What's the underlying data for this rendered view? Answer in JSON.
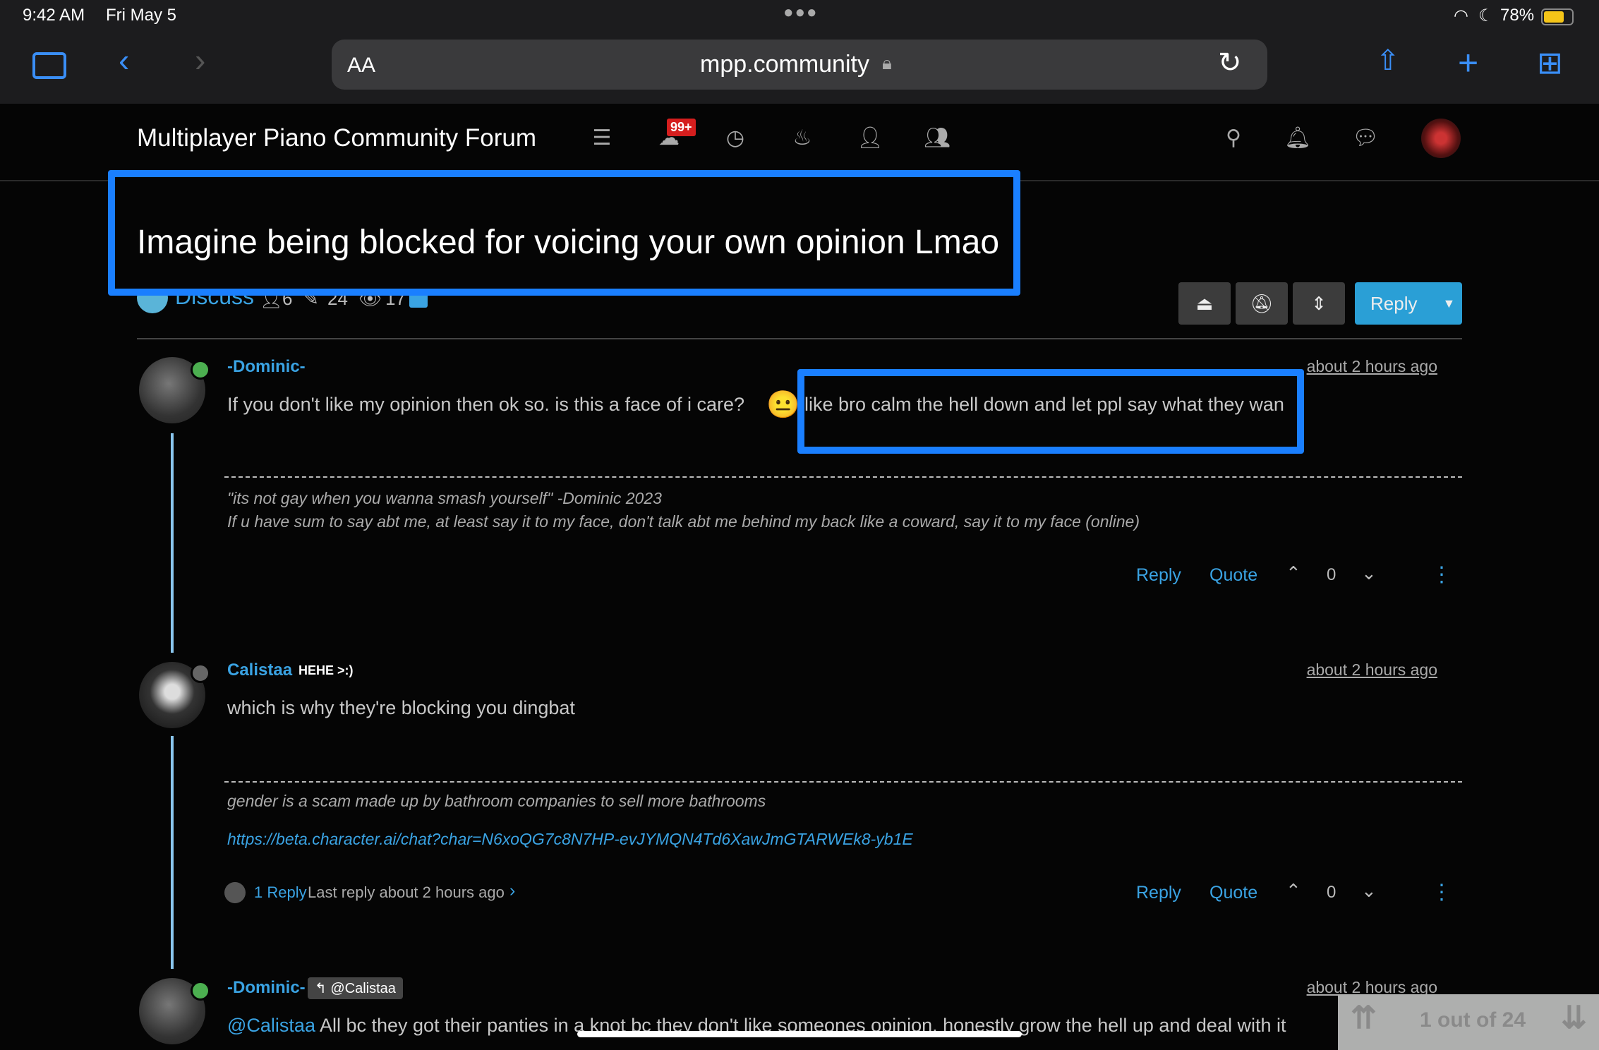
{
  "status_bar": {
    "time": "9:42 AM",
    "date": "Fri May 5",
    "battery": "78%"
  },
  "browser": {
    "text_size": "AA",
    "url": "mpp.community"
  },
  "forum": {
    "title": "Multiplayer Piano Community Forum",
    "unread_badge": "99+"
  },
  "topic": {
    "title": "Imagine being blocked for voicing your own opinion Lmao",
    "category": "Discuss",
    "posters": "6",
    "posts": "24",
    "views": "17",
    "reply_label": "Reply"
  },
  "posts": [
    {
      "author": "-Dominic-",
      "time": "about 2 hours ago",
      "body": "If you don't like my opinion then ok so. is this a face of i care?",
      "emoji": "😐",
      "body2": "like bro calm the hell down and let ppl say what they wan",
      "sig": [
        "\"its not gay when you wanna smash yourself\" -Dominic 2023",
        "If u have sum to say abt me, at least say it to my face, don't talk abt me behind my back like a coward, say it to my face (online)"
      ],
      "votes": "0",
      "online": true
    },
    {
      "author": "Calistaa",
      "badge": "HEHE >:)",
      "time": "about 2 hours ago",
      "body": "which is why they're blocking you dingbat",
      "sig": [
        "gender is a scam made up by bathroom companies to sell more bathrooms"
      ],
      "link": "https://beta.character.ai/chat?char=N6xoQG7c8N7HP-evJYMQN4Td6XawJmGTARWEk8-yb1E",
      "replies": "1 Reply",
      "last_reply": "Last reply about 2 hours ago",
      "votes": "0",
      "online": false
    },
    {
      "author": "-Dominic-",
      "reply_to": "@Calistaa",
      "time": "about 2 hours ago",
      "mention": "@Calistaa",
      "body": "All bc they got their panties in a knot bc they don't like someones opinion. honestly grow the hell up and deal with it",
      "online": true
    }
  ],
  "actions": {
    "reply": "Reply",
    "quote": "Quote"
  },
  "pagination": {
    "text": "1 out of 24"
  },
  "colors": {
    "accent": "#3aa3e3",
    "highlight": "#1a7fff",
    "online": "#4caf50"
  }
}
